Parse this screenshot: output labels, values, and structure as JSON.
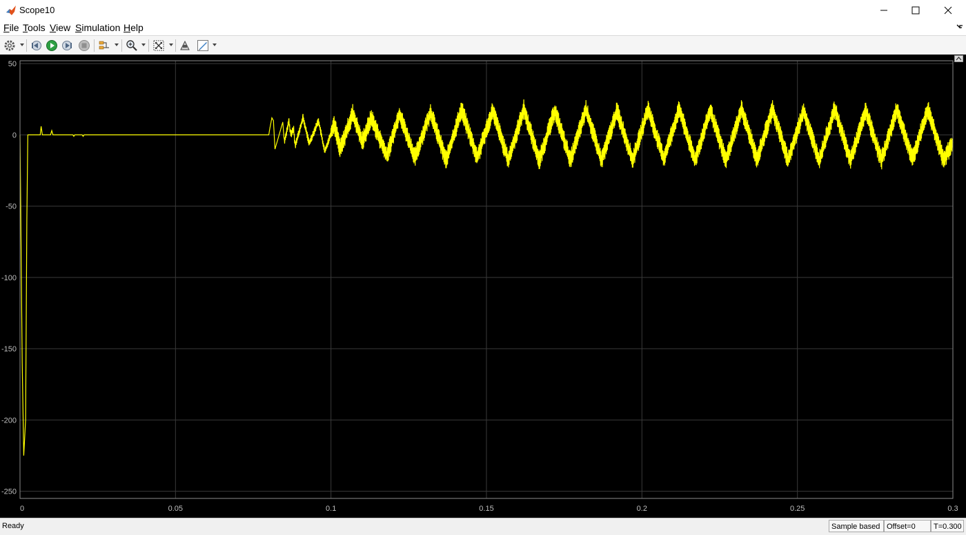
{
  "window": {
    "title": "Scope10",
    "minimize_icon": "minimize-icon",
    "maximize_icon": "maximize-icon",
    "close_icon": "close-icon"
  },
  "menu": {
    "items": [
      {
        "mnemonic": "F",
        "rest": "ile"
      },
      {
        "mnemonic": "T",
        "rest": "ools"
      },
      {
        "mnemonic": "V",
        "rest": "iew"
      },
      {
        "mnemonic": "S",
        "rest": "imulation"
      },
      {
        "mnemonic": "H",
        "rest": "elp"
      }
    ]
  },
  "toolbar": {
    "icons": [
      "settings-icon",
      "step-back-icon",
      "run-icon",
      "step-forward-icon",
      "stop-icon",
      "highlight-icon",
      "zoom-icon",
      "autoscale-icon",
      "signal-select-icon",
      "style-icon"
    ],
    "colors": {
      "run": "#2ea043",
      "stop": "#9a9a9a"
    }
  },
  "plot": {
    "background": "#000000",
    "line_color": "#ffff00",
    "grid_color": "#3a3a3a"
  },
  "chart_data": {
    "type": "line",
    "title": "",
    "xlabel": "",
    "ylabel": "",
    "xlim": [
      0,
      0.3
    ],
    "ylim": [
      -255,
      52
    ],
    "x_ticks": [
      0,
      0.05,
      0.1,
      0.15,
      0.2,
      0.25,
      0.3
    ],
    "x_tick_labels": [
      "0",
      "0.05",
      "0.1",
      "0.15",
      "0.2",
      "0.25",
      "0.3"
    ],
    "y_ticks": [
      50,
      0,
      -50,
      -100,
      -150,
      -200,
      -250
    ],
    "y_tick_labels": [
      "50",
      "0",
      "-50",
      "-100",
      "-150",
      "-200",
      "-250"
    ],
    "grid": true,
    "series": [
      {
        "points": [
          [
            0,
            0
          ],
          [
            0.0007,
            -160
          ],
          [
            0.0012,
            -225
          ],
          [
            0.0018,
            -200
          ],
          [
            0.0022,
            -60
          ],
          [
            0.0025,
            0
          ],
          [
            0.004,
            0
          ],
          [
            0.0065,
            0
          ],
          [
            0.0068,
            6
          ],
          [
            0.0072,
            0
          ],
          [
            0.0098,
            0
          ],
          [
            0.0102,
            3
          ],
          [
            0.0106,
            0
          ],
          [
            0.017,
            0
          ],
          [
            0.0173,
            -1
          ],
          [
            0.0176,
            0
          ],
          [
            0.02,
            0
          ],
          [
            0.0203,
            -1
          ],
          [
            0.0206,
            0
          ],
          [
            0.08,
            0
          ],
          [
            0.0803,
            4
          ],
          [
            0.081,
            12
          ],
          [
            0.0815,
            10
          ],
          [
            0.082,
            -10
          ],
          [
            0.0845,
            9
          ],
          [
            0.085,
            -5
          ],
          [
            0.0865,
            10
          ],
          [
            0.087,
            0
          ],
          [
            0.088,
            4
          ],
          [
            0.0885,
            -8
          ],
          [
            0.091,
            12
          ],
          [
            0.093,
            -6
          ],
          [
            0.096,
            10
          ],
          [
            0.098,
            -12
          ],
          [
            0.101,
            8
          ],
          [
            0.103,
            -10
          ],
          [
            0.107,
            15
          ],
          [
            0.11,
            -5
          ],
          [
            0.113,
            12
          ],
          [
            0.118,
            -15
          ],
          [
            0.122,
            15
          ],
          [
            0.127,
            -16
          ],
          [
            0.132,
            16
          ],
          [
            0.137,
            -18
          ],
          [
            0.142,
            18
          ],
          [
            0.147,
            -16
          ],
          [
            0.152,
            17
          ],
          [
            0.157,
            -18
          ],
          [
            0.162,
            18
          ],
          [
            0.167,
            -18
          ],
          [
            0.172,
            17
          ],
          [
            0.177,
            -18
          ],
          [
            0.182,
            18
          ],
          [
            0.187,
            -18
          ],
          [
            0.192,
            17
          ],
          [
            0.197,
            -18
          ],
          [
            0.202,
            18
          ],
          [
            0.207,
            -17
          ],
          [
            0.212,
            18
          ],
          [
            0.217,
            -18
          ],
          [
            0.222,
            17
          ],
          [
            0.227,
            -18
          ],
          [
            0.232,
            18
          ],
          [
            0.237,
            -17
          ],
          [
            0.242,
            18
          ],
          [
            0.247,
            -18
          ],
          [
            0.252,
            17
          ],
          [
            0.257,
            -18
          ],
          [
            0.262,
            18
          ],
          [
            0.267,
            -18
          ],
          [
            0.272,
            17
          ],
          [
            0.277,
            -18
          ],
          [
            0.282,
            18
          ],
          [
            0.287,
            -17
          ],
          [
            0.292,
            18
          ],
          [
            0.297,
            -18
          ],
          [
            0.3,
            -5
          ]
        ],
        "ripple_amplitude": 7
      }
    ]
  },
  "status": {
    "text": "Ready",
    "mode": "Sample based",
    "offset": "Offset=0",
    "time": "T=0.300"
  }
}
